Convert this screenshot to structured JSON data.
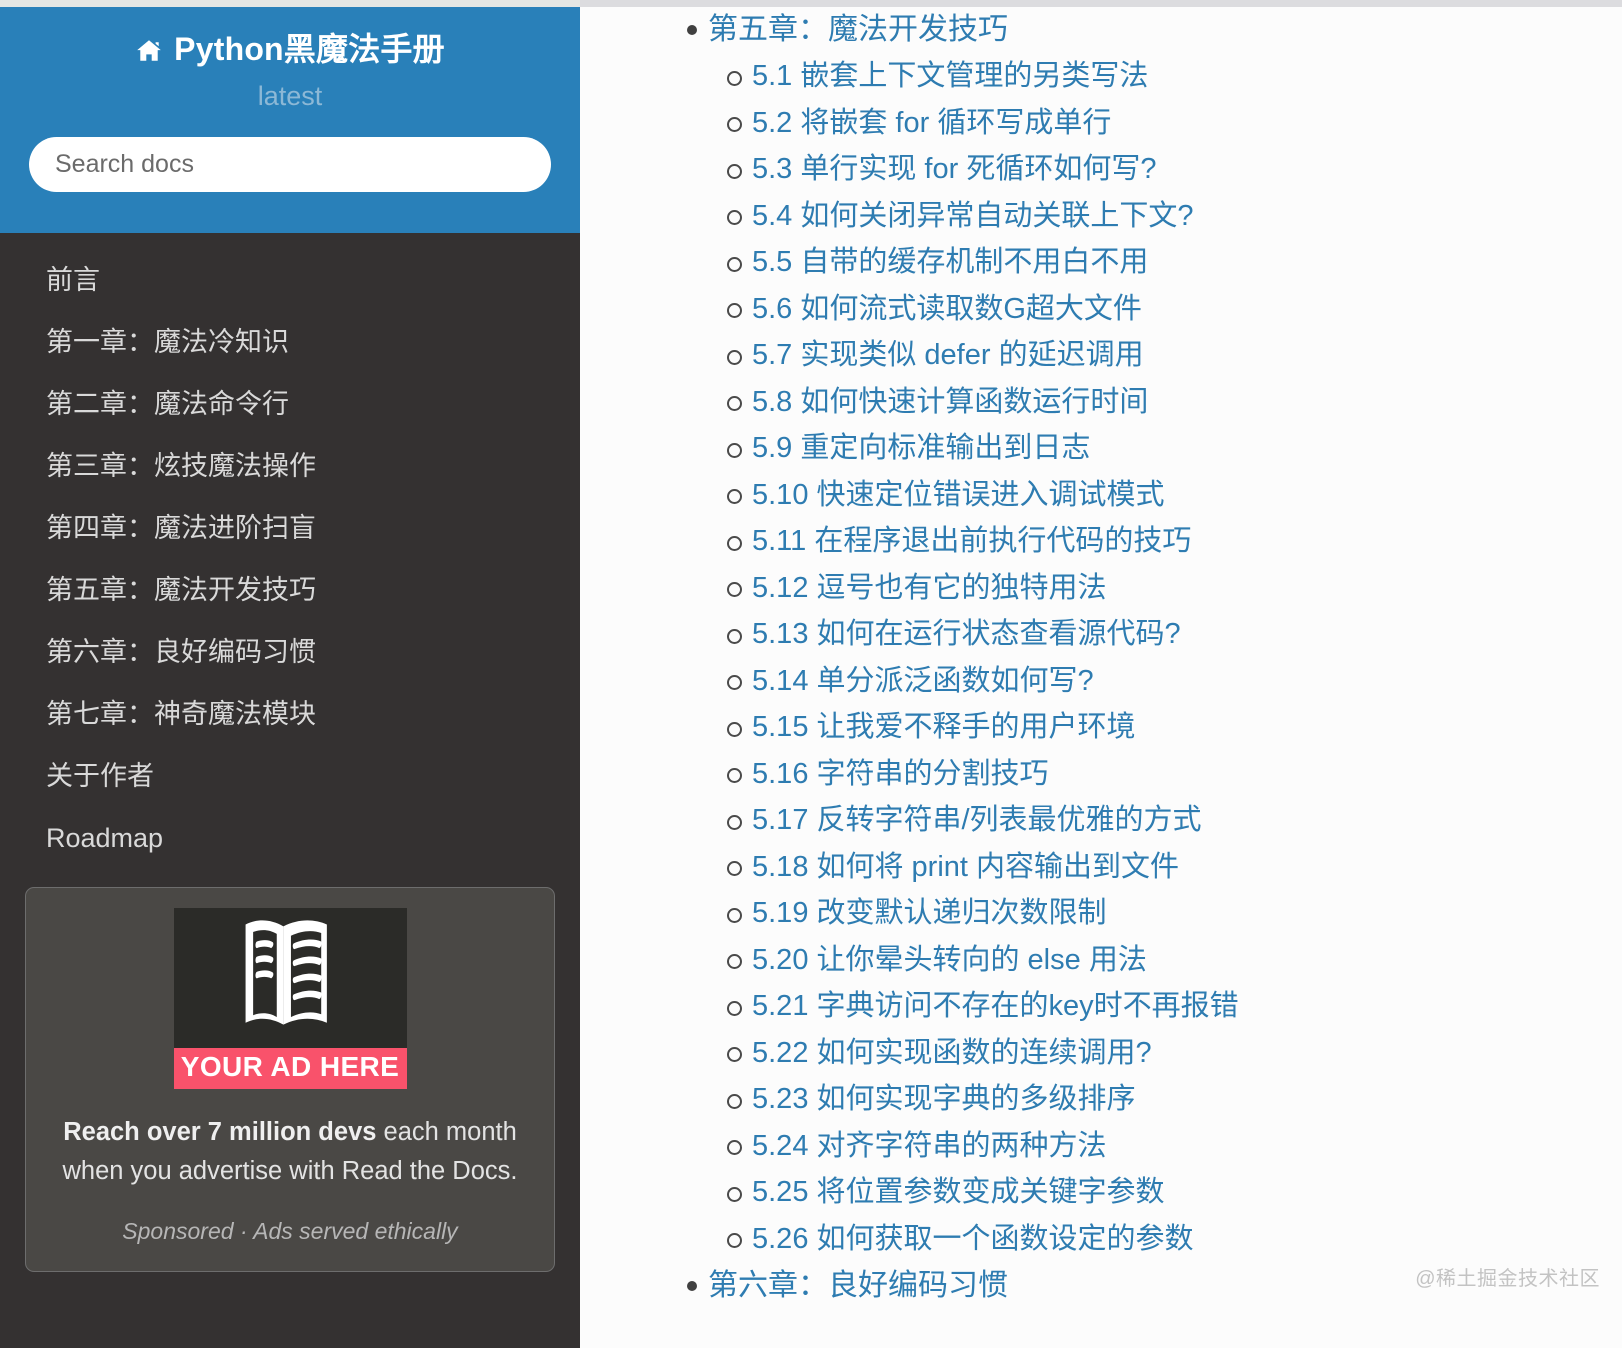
{
  "sidebar": {
    "home_icon": "home-icon",
    "title": "Python黑魔法手册",
    "version": "latest",
    "search_placeholder": "Search docs",
    "search_value": "",
    "nav_items": [
      "前言",
      "第一章：魔法冷知识",
      "第二章：魔法命令行",
      "第三章：炫技魔法操作",
      "第四章：魔法进阶扫盲",
      "第五章：魔法开发技巧",
      "第六章：良好编码习惯",
      "第七章：神奇魔法模块",
      "关于作者",
      "Roadmap"
    ],
    "ad": {
      "image_icon": "open-book-icon",
      "badge": "YOUR AD HERE",
      "headline_bold": "Reach over 7 million devs",
      "headline_rest": " each month when you advertise with Read the Docs.",
      "footer": "Sponsored · Ads served ethically",
      "badge_color": "#f9526b",
      "panel_color": "#4a4845"
    },
    "header_color": "#2980b9",
    "body_color": "#343131"
  },
  "main": {
    "link_color": "#2e7cb1",
    "chapters": [
      {
        "label": "第五章：魔法开发技巧",
        "sections": [
          "5.1 嵌套上下文管理的另类写法",
          "5.2 将嵌套 for 循环写成单行",
          "5.3 单行实现 for 死循环如何写?",
          "5.4 如何关闭异常自动关联上下文?",
          "5.5 自带的缓存机制不用白不用",
          "5.6 如何流式读取数G超大文件",
          "5.7 实现类似 defer 的延迟调用",
          "5.8 如何快速计算函数运行时间",
          "5.9 重定向标准输出到日志",
          "5.10 快速定位错误进入调试模式",
          "5.11 在程序退出前执行代码的技巧",
          "5.12 逗号也有它的独特用法",
          "5.13 如何在运行状态查看源代码?",
          "5.14 单分派泛函数如何写?",
          "5.15 让我爱不释手的用户环境",
          "5.16 字符串的分割技巧",
          "5.17 反转字符串/列表最优雅的方式",
          "5.18 如何将 print 内容输出到文件",
          "5.19 改变默认递归次数限制",
          "5.20 让你晕头转向的 else 用法",
          "5.21 字典访问不存在的key时不再报错",
          "5.22 如何实现函数的连续调用?",
          "5.23 如何实现字典的多级排序",
          "5.24 对齐字符串的两种方法",
          "5.25 将位置参数变成关键字参数",
          "5.26 如何获取一个函数设定的参数"
        ]
      },
      {
        "label": "第六章：良好编码习惯",
        "sections": []
      }
    ],
    "watermark": "@稀土掘金技术社区"
  }
}
